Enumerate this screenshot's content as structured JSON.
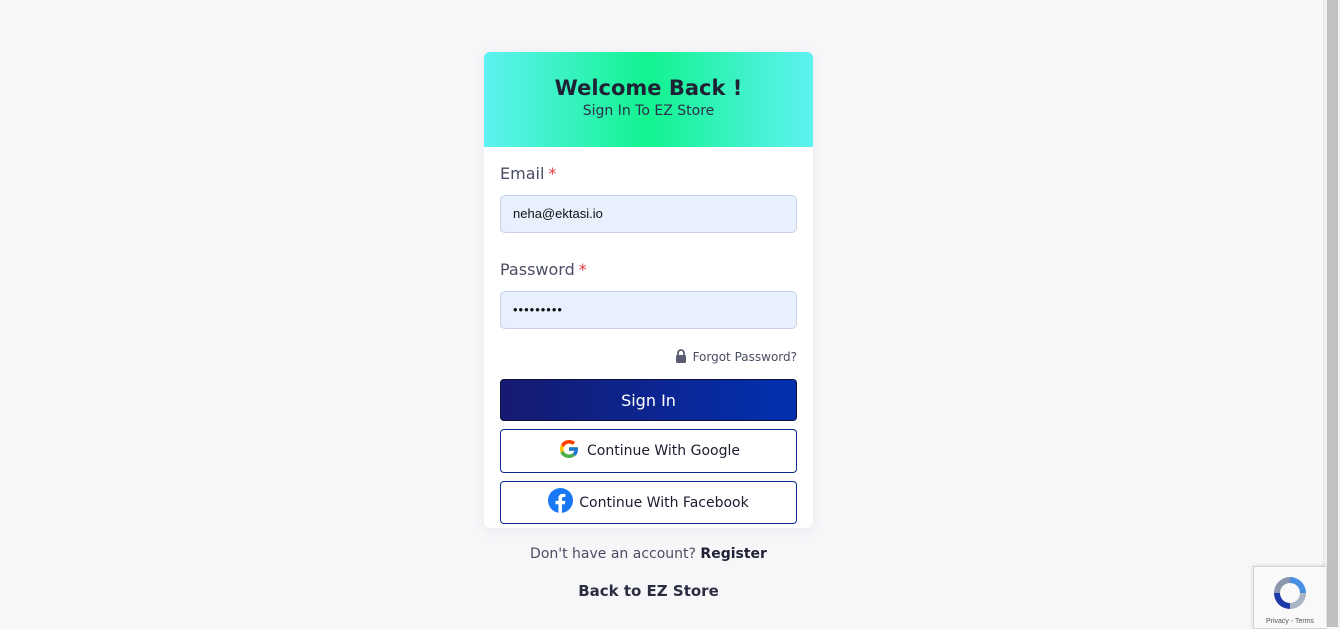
{
  "header": {
    "title": "Welcome Back !",
    "subtitle": "Sign In To EZ Store"
  },
  "form": {
    "email_label": "Email",
    "email_value": "neha@ektasi.io",
    "password_label": "Password",
    "password_value": "•••••••••",
    "required_marker": "*",
    "forgot_password": "Forgot Password?"
  },
  "buttons": {
    "sign_in": "Sign In",
    "google": "Continue With Google",
    "facebook": "Continue With Facebook"
  },
  "footer": {
    "register_prompt": "Don't have an account?",
    "register_link": "Register",
    "back_link": "Back to EZ Store"
  },
  "recaptcha": {
    "terms": "Privacy - Terms"
  },
  "colors": {
    "header_gradient_start": "#5ef2f2",
    "header_gradient_mid": "#12f38f",
    "signin_gradient_start": "#161a70",
    "signin_gradient_end": "#0230b0",
    "social_border": "#0a2a8f",
    "required": "#e0393e",
    "input_background": "#e8f0fe"
  },
  "icons": {
    "forgot": "lock-icon",
    "google": "google-icon",
    "facebook": "facebook-icon",
    "recaptcha": "recaptcha-icon"
  }
}
